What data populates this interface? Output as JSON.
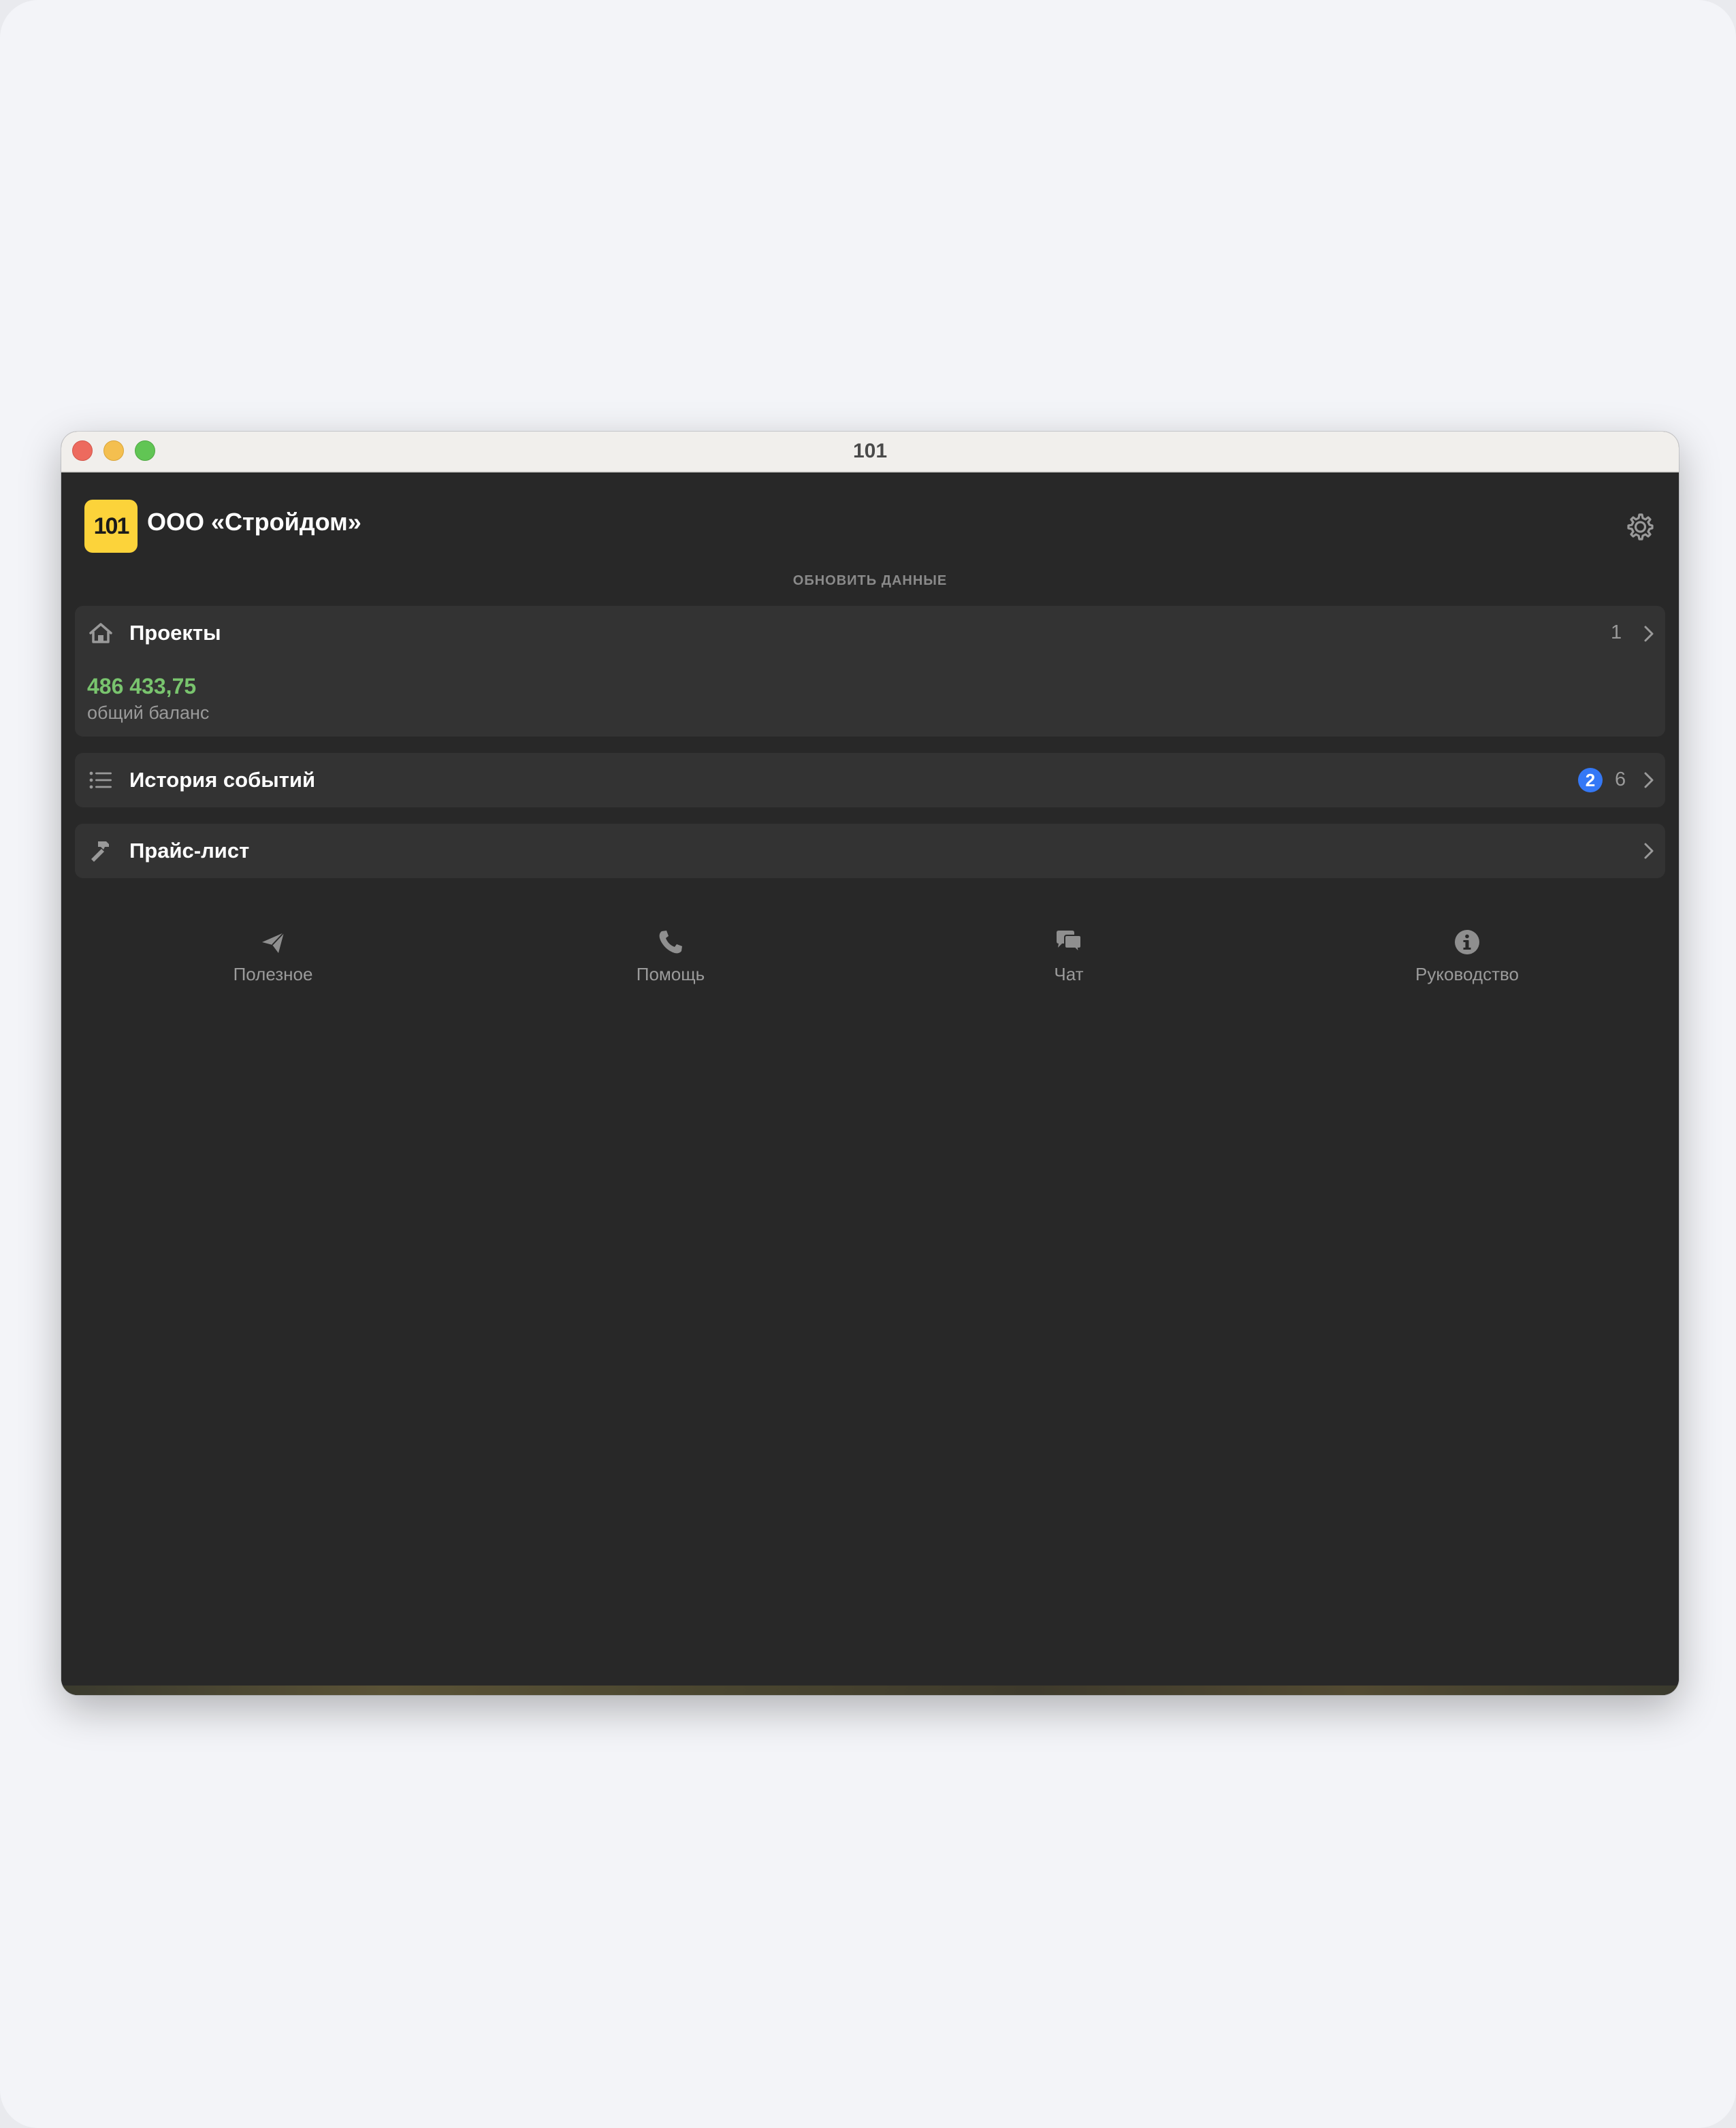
{
  "window": {
    "title": "101"
  },
  "header": {
    "logo_text": "101",
    "company": "ООО «Стройдом»",
    "settings_icon": "gear-icon"
  },
  "refresh_label": "ОБНОВИТЬ ДАННЫЕ",
  "projects": {
    "title": "Проекты",
    "count": "1",
    "balance_value": "486 433,75",
    "balance_label": "общий баланс",
    "icon": "house-icon"
  },
  "history": {
    "title": "История событий",
    "badge": "2",
    "count": "6",
    "icon": "list-icon"
  },
  "price_list": {
    "title": "Прайс-лист",
    "icon": "hammer-icon"
  },
  "bottom_nav": [
    {
      "label": "Полезное",
      "icon": "paper-plane-icon"
    },
    {
      "label": "Помощь",
      "icon": "phone-icon"
    },
    {
      "label": "Чат",
      "icon": "chat-bubbles-icon"
    },
    {
      "label": "Руководство",
      "icon": "info-icon"
    }
  ],
  "colors": {
    "background": "#282828",
    "card": "#333333",
    "accent_yellow": "#fcd33a",
    "balance_green": "#79c46e",
    "badge_blue": "#3478f6"
  }
}
